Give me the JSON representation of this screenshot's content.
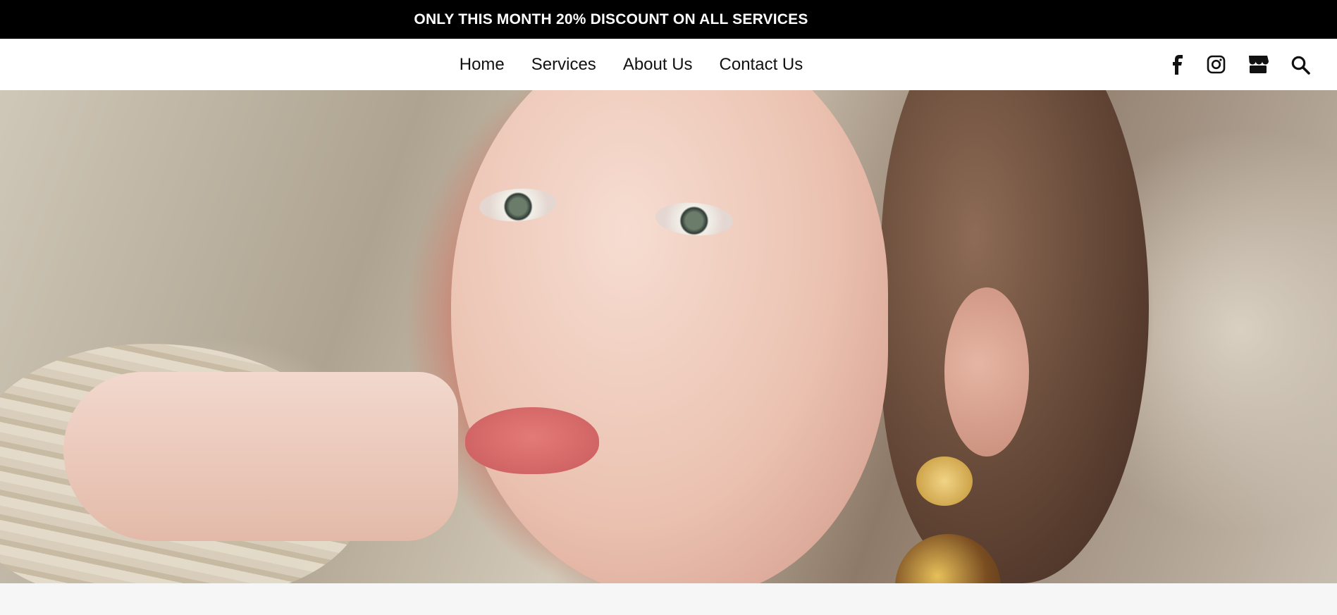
{
  "announcement": "ONLY THIS MONTH 20% DISCOUNT ON ALL SERVICES",
  "nav": {
    "items": [
      {
        "label": "Home"
      },
      {
        "label": "Services"
      },
      {
        "label": "About Us"
      },
      {
        "label": "Contact Us"
      }
    ],
    "icons": [
      "facebook-icon",
      "instagram-icon",
      "store-icon",
      "search-icon"
    ]
  },
  "colors": {
    "announcement_bg": "#000000",
    "announcement_text": "#ffffff",
    "nav_bg": "#ffffff",
    "page_bg": "#f6f6f6"
  }
}
